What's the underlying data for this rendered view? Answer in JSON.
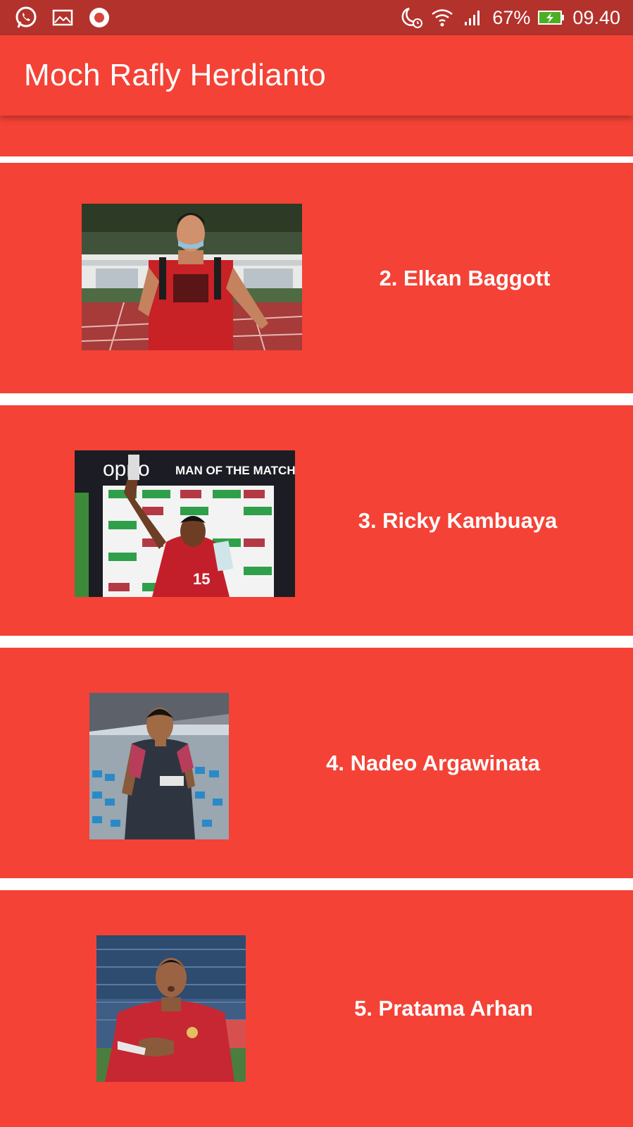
{
  "status_bar": {
    "battery": "67%",
    "time": "09.40",
    "icons": [
      "whatsapp-icon",
      "gallery-icon",
      "record-icon",
      "do-not-disturb-alarm-icon",
      "wifi-icon",
      "signal-icon",
      "battery-charging-icon"
    ]
  },
  "app_bar": {
    "title": "Moch Rafly Herdianto",
    "color": "#f44236"
  },
  "players": [
    {
      "name": "2. Elkan Baggott",
      "photo_icon": "player-photo-elkan-baggott"
    },
    {
      "name": "3. Ricky Kambuaya",
      "photo_icon": "player-photo-ricky-kambuaya"
    },
    {
      "name": "4. Nadeo Argawinata",
      "photo_icon": "player-photo-nadeo-argawinata"
    },
    {
      "name": "5. Pratama Arhan",
      "photo_icon": "player-photo-pratama-arhan"
    }
  ],
  "photo_texts": {
    "brand": "oppo",
    "banner": "MAN OF THE MATCH",
    "jersey_number": "15"
  }
}
